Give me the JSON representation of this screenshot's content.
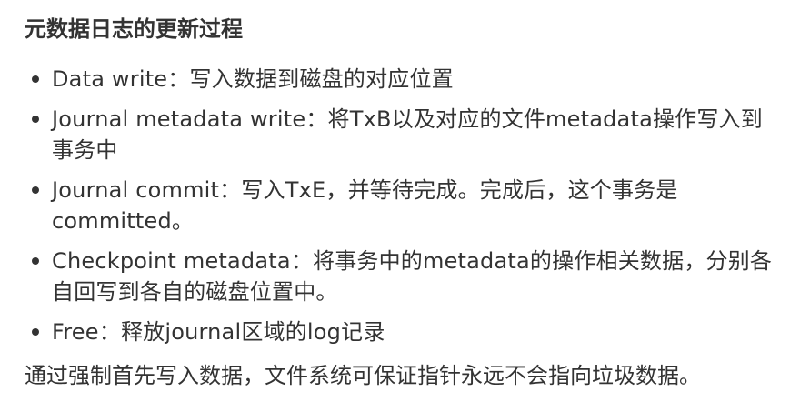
{
  "heading": "元数据日志的更新过程",
  "steps": [
    {
      "term": "Data write",
      "sep": "：",
      "desc": "写入数据到磁盘的对应位置"
    },
    {
      "term": "Journal metadata write",
      "sep": "：",
      "desc": "将TxB以及对应的文件metadata操作写入到事务中"
    },
    {
      "term": "Journal commit",
      "sep": "：",
      "desc": "写入TxE，并等待完成。完成后，这个事务是committed。"
    },
    {
      "term": "Checkpoint metadata",
      "sep": "：",
      "desc": "将事务中的metadata的操作相关数据，分别各自回写到各自的磁盘位置中。"
    },
    {
      "term": "Free",
      "sep": "：",
      "desc": "释放journal区域的log记录"
    }
  ],
  "summary": "通过强制首先写入数据，文件系统可保证指针永远不会指向垃圾数据。"
}
